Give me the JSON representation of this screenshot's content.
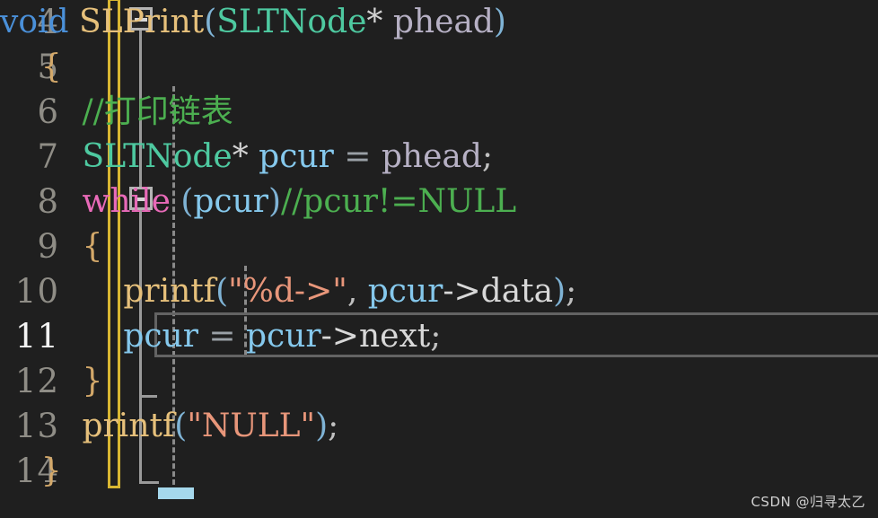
{
  "editor": {
    "background_color": "#1f1f1f",
    "language": "c",
    "active_line": 11,
    "first_visible_line": 4,
    "last_visible_line": 14
  },
  "gutter": {
    "line_numbers": [
      "4",
      "5",
      "6",
      "7",
      "8",
      "9",
      "10",
      "11",
      "12",
      "13",
      "14"
    ],
    "active_line_number": "11",
    "line_number_color": "#8f8d86",
    "active_line_number_color": "#f2f2f2",
    "change_bar_color": "#d8b632"
  },
  "fold_markers": [
    {
      "name": "fold-marker-line-4",
      "line": "4",
      "state": "expanded",
      "glyph": "minus-box"
    },
    {
      "name": "fold-marker-line-8",
      "line": "8",
      "state": "expanded",
      "glyph": "minus-box"
    }
  ],
  "code": {
    "lines": [
      {
        "number": "4",
        "text": "void SLPrint(SLTNode* phead)",
        "tokens": [
          {
            "text": "void",
            "cls": "t-kw"
          },
          {
            "text": " ",
            "cls": "t-plain"
          },
          {
            "text": "SLPrint",
            "cls": "t-fn"
          },
          {
            "text": "(",
            "cls": "t-paren"
          },
          {
            "text": "SLTNode",
            "cls": "t-type"
          },
          {
            "text": "*",
            "cls": "t-plain"
          },
          {
            "text": " ",
            "cls": "t-plain"
          },
          {
            "text": "phead",
            "cls": "t-param"
          },
          {
            "text": ")",
            "cls": "t-paren"
          }
        ]
      },
      {
        "number": "5",
        "text": "{",
        "tokens": [
          {
            "text": "    ",
            "cls": "ind"
          },
          {
            "text": "{",
            "cls": "t-brace"
          }
        ]
      },
      {
        "number": "6",
        "text": "    //打印链表",
        "tokens": [
          {
            "text": "        ",
            "cls": "ind"
          },
          {
            "text": "//打印链表",
            "cls": "t-comment"
          }
        ]
      },
      {
        "number": "7",
        "text": "    SLTNode* pcur = phead;",
        "tokens": [
          {
            "text": "        ",
            "cls": "ind"
          },
          {
            "text": "SLTNode",
            "cls": "t-type"
          },
          {
            "text": "*",
            "cls": "t-plain"
          },
          {
            "text": " ",
            "cls": "t-plain"
          },
          {
            "text": "pcur",
            "cls": "t-var"
          },
          {
            "text": " ",
            "cls": "t-plain"
          },
          {
            "text": "=",
            "cls": "t-op"
          },
          {
            "text": " ",
            "cls": "t-plain"
          },
          {
            "text": "phead",
            "cls": "t-param"
          },
          {
            "text": ";",
            "cls": "t-punct"
          }
        ]
      },
      {
        "number": "8",
        "text": "    while (pcur)//pcur!=NULL",
        "tokens": [
          {
            "text": "        ",
            "cls": "ind"
          },
          {
            "text": "while",
            "cls": "t-ctrl"
          },
          {
            "text": " ",
            "cls": "t-plain"
          },
          {
            "text": "(",
            "cls": "t-paren"
          },
          {
            "text": "pcur",
            "cls": "t-var"
          },
          {
            "text": ")",
            "cls": "t-paren"
          },
          {
            "text": "//pcur!=NULL",
            "cls": "t-comment"
          }
        ]
      },
      {
        "number": "9",
        "text": "    {",
        "tokens": [
          {
            "text": "        ",
            "cls": "ind"
          },
          {
            "text": "{",
            "cls": "t-brace"
          }
        ]
      },
      {
        "number": "10",
        "text": "        printf(\"%d->\", pcur->data);",
        "tokens": [
          {
            "text": "            ",
            "cls": "ind"
          },
          {
            "text": "printf",
            "cls": "t-fn"
          },
          {
            "text": "(",
            "cls": "t-paren"
          },
          {
            "text": "\"%d->\"",
            "cls": "t-string"
          },
          {
            "text": ",",
            "cls": "t-punct"
          },
          {
            "text": " ",
            "cls": "t-plain"
          },
          {
            "text": "pcur",
            "cls": "t-var"
          },
          {
            "text": "->",
            "cls": "t-member"
          },
          {
            "text": "data",
            "cls": "t-member"
          },
          {
            "text": ")",
            "cls": "t-paren"
          },
          {
            "text": ";",
            "cls": "t-punct"
          }
        ]
      },
      {
        "number": "11",
        "text": "        pcur = pcur->next;",
        "tokens": [
          {
            "text": "            ",
            "cls": "ind"
          },
          {
            "text": "pcur",
            "cls": "t-var"
          },
          {
            "text": " ",
            "cls": "t-plain"
          },
          {
            "text": "=",
            "cls": "t-op"
          },
          {
            "text": " ",
            "cls": "t-plain"
          },
          {
            "text": "pcur",
            "cls": "t-var"
          },
          {
            "text": "->",
            "cls": "t-member"
          },
          {
            "text": "next",
            "cls": "t-member"
          },
          {
            "text": ";",
            "cls": "t-punct"
          }
        ]
      },
      {
        "number": "12",
        "text": "    }",
        "tokens": [
          {
            "text": "        ",
            "cls": "ind"
          },
          {
            "text": "}",
            "cls": "t-brace"
          }
        ]
      },
      {
        "number": "13",
        "text": "    printf(\"NULL\");",
        "tokens": [
          {
            "text": "        ",
            "cls": "ind"
          },
          {
            "text": "printf",
            "cls": "t-fn"
          },
          {
            "text": "(",
            "cls": "t-paren"
          },
          {
            "text": "\"NULL\"",
            "cls": "t-string"
          },
          {
            "text": ")",
            "cls": "t-paren"
          },
          {
            "text": ";",
            "cls": "t-punct"
          }
        ]
      },
      {
        "number": "14",
        "text": "}",
        "tokens": [
          {
            "text": "    ",
            "cls": "ind"
          },
          {
            "text": "}",
            "cls": "t-brace"
          }
        ]
      }
    ]
  },
  "cursor": {
    "line": "14",
    "color": "#a5d8ec",
    "shape": "underline-block"
  },
  "watermark": {
    "text": "CSDN @归寻太乙"
  }
}
